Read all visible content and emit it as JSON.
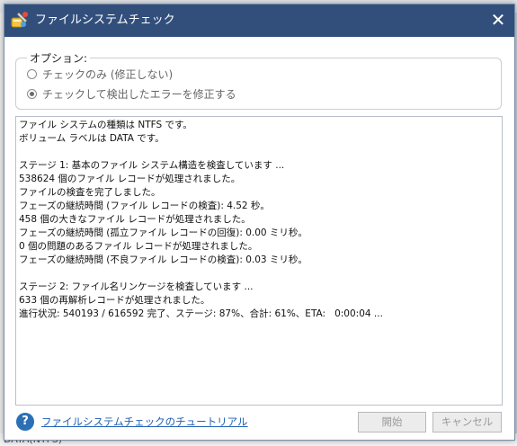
{
  "dialog": {
    "title": "ファイルシステムチェック",
    "close_glyph": "✕"
  },
  "options": {
    "legend": "オプション:",
    "items": [
      {
        "label": "チェックのみ (修正しない)",
        "checked": false
      },
      {
        "label": "チェックして検出したエラーを修正する",
        "checked": true
      }
    ]
  },
  "log": {
    "lines": [
      "ファイル システムの種類は NTFS です。",
      "ボリューム ラベルは DATA です。",
      "",
      "ステージ 1: 基本のファイル システム構造を検査しています ...",
      "538624 個のファイル レコードが処理されました。",
      "ファイルの検査を完了しました。",
      "フェーズの継続時間 (ファイル レコードの検査): 4.52 秒。",
      "458 個の大きなファイル レコードが処理されました。",
      "フェーズの継続時間 (孤立ファイル レコードの回復): 0.00 ミリ秒。",
      "0 個の問題のあるファイル レコードが処理されました。",
      "フェーズの継続時間 (不良ファイル レコードの検査): 0.03 ミリ秒。",
      "",
      "ステージ 2: ファイル名リンケージを検査しています ...",
      "633 個の再解析レコードが処理されました。",
      "進行状況: 540193 / 616592 完了、ステージ: 87%、合計: 61%、ETA:   0:00:04 ..."
    ]
  },
  "footer": {
    "help_glyph": "?",
    "tutorial_link": "ファイルシステムチェックのチュートリアル",
    "start_button": "開始",
    "cancel_button": "キャンセル"
  },
  "background": {
    "bottom_text": "DATA(NTFS)"
  }
}
